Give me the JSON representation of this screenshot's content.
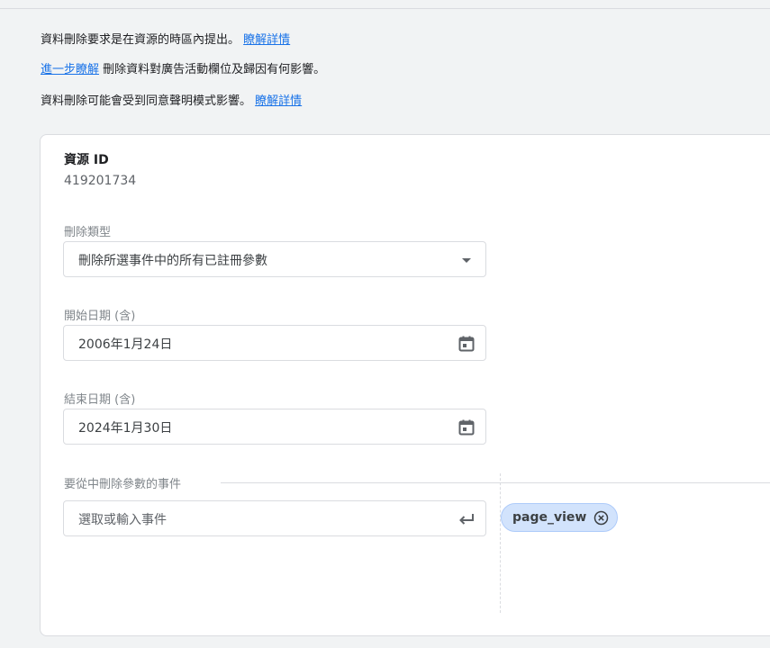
{
  "notices": {
    "line1_text": "資料刪除要求是在資源的時區內提出。",
    "line1_link": "瞭解詳情",
    "line2_link": "進一步瞭解",
    "line2_text": "刪除資料對廣告活動欄位及歸因有何影響。",
    "line3_text": "資料刪除可能會受到同意聲明模式影響。",
    "line3_link": "瞭解詳情"
  },
  "property": {
    "label": "資源 ID",
    "value": "419201734"
  },
  "deletion_type": {
    "label": "刪除類型",
    "value": "刪除所選事件中的所有已註冊參數",
    "icon": "dropdown-arrow-icon"
  },
  "start_date": {
    "label": "開始日期 (含)",
    "value": "2006年1月24日",
    "icon": "calendar-icon"
  },
  "end_date": {
    "label": "結束日期 (含)",
    "value": "2024年1月30日",
    "icon": "calendar-icon"
  },
  "events": {
    "section_title": "要從中刪除參數的事件",
    "input_placeholder": "選取或輸入事件",
    "input_icon": "enter-icon",
    "chips": [
      "page_view"
    ]
  },
  "colors": {
    "link": "#1a73e8",
    "chip_bg": "#d2e3fc",
    "page_bg": "#f1f3f4"
  }
}
